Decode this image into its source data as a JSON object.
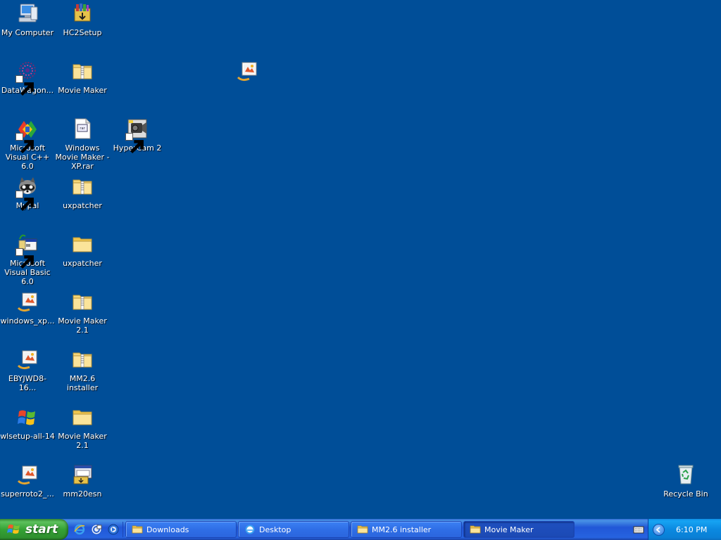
{
  "desktop": {
    "icons": [
      {
        "label": "My Computer",
        "icon": "computer-icon"
      },
      {
        "label": "HC2Setup",
        "icon": "installer-box-icon"
      },
      {
        "label": "DataWagon...",
        "icon": "datawagon-icon"
      },
      {
        "label": "Movie Maker",
        "icon": "zip-folder-icon"
      },
      {
        "label": "Microsoft Visual C++ 6.0",
        "icon": "visual-cpp-icon"
      },
      {
        "label": "Windows Movie Maker - XP.rar",
        "icon": "rar-file-icon"
      },
      {
        "label": "HyperCam 2",
        "icon": "hypercam-icon"
      },
      {
        "label": "Mypal",
        "icon": "raccoon-icon"
      },
      {
        "label": "uxpatcher",
        "icon": "zip-folder-icon"
      },
      {
        "label": "Microsoft Visual Basic 6.0",
        "icon": "visual-basic-icon"
      },
      {
        "label": "uxpatcher",
        "icon": "folder-icon"
      },
      {
        "label": "windows_xp...",
        "icon": "picture-file-icon"
      },
      {
        "label": "Movie Maker 2.1",
        "icon": "zip-folder-icon"
      },
      {
        "label": "EBYJWD8-16...",
        "icon": "picture-file-icon"
      },
      {
        "label": "MM2.6 installer",
        "icon": "zip-folder-icon"
      },
      {
        "label": "wlsetup-all-14",
        "icon": "windows-logo-icon"
      },
      {
        "label": "Movie Maker 2.1",
        "icon": "folder-icon"
      },
      {
        "label": "superroto2_...",
        "icon": "picture-file-icon"
      },
      {
        "label": "mm20esn",
        "icon": "setup-program-icon"
      },
      {
        "label": "Recycle Bin",
        "icon": "recycle-bin-icon"
      }
    ]
  },
  "taskbar": {
    "start_label": "start",
    "quick_launch": [
      "internet-explorer-icon",
      "outlook-express-icon",
      "media-player-icon"
    ],
    "buttons": [
      {
        "label": "Downloads",
        "icon": "folder-icon",
        "active": false
      },
      {
        "label": "Desktop",
        "icon": "ie-window-icon",
        "active": false
      },
      {
        "label": "MM2.6 installer",
        "icon": "folder-icon",
        "active": false
      },
      {
        "label": "Movie Maker",
        "icon": "folder-icon",
        "active": true
      }
    ],
    "clock": "6:10 PM"
  },
  "colors": {
    "desktop_background": "#004e98",
    "taskbar_blue": "#245edb",
    "start_green": "#3c9a3c",
    "tray_blue": "#0f8fe7"
  }
}
